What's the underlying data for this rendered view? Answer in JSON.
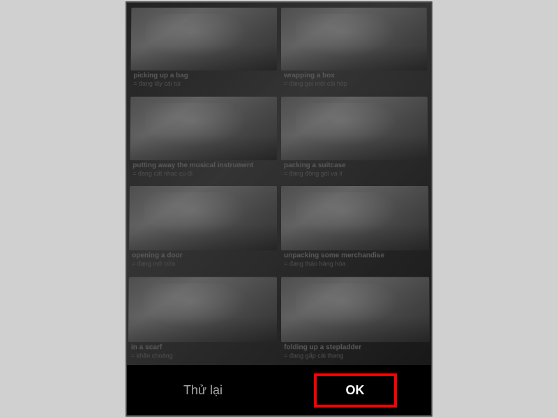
{
  "buttons": {
    "retry_label": "Thử lại",
    "ok_label": "OK"
  },
  "vocab": [
    {
      "en": "picking up a bag",
      "vi": "= đang lấy cái túi"
    },
    {
      "en": "wrapping a box",
      "vi": "= đang gói một cái hộp"
    },
    {
      "en": "putting away the musical instrument",
      "vi": "= đang cất nhạc cụ đi"
    },
    {
      "en": "packing a suitcase",
      "vi": "= đang đóng gói va li"
    },
    {
      "en": "opening a door",
      "vi": "= đang mở cửa"
    },
    {
      "en": "unpacking some merchandise",
      "vi": "= đang tháo hàng hóa"
    },
    {
      "en": "in a scarf",
      "vi": "= khăn choàng"
    },
    {
      "en": "folding up a stepladder",
      "vi": "= đang gấp cái thang"
    }
  ]
}
